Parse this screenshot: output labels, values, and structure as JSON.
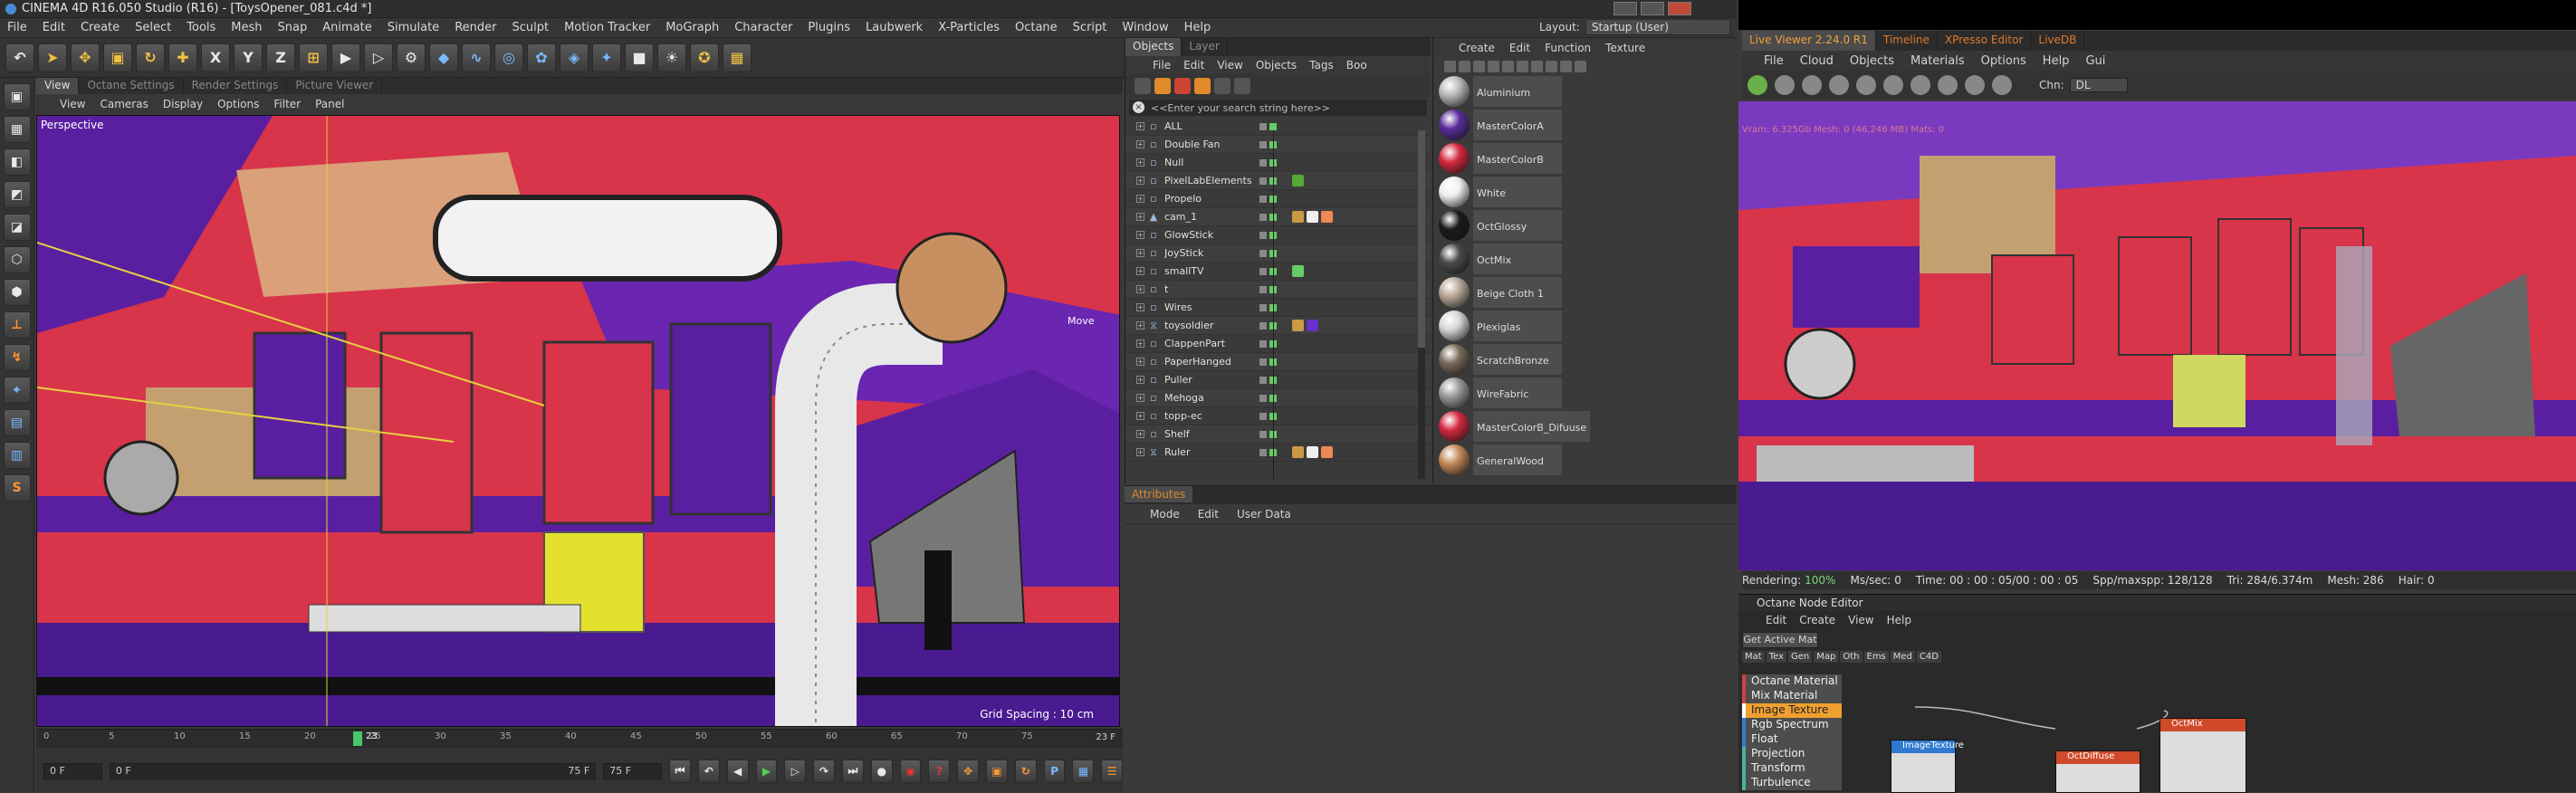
{
  "app": {
    "title": "CINEMA 4D R16.050 Studio (R16) - [ToysOpener_081.c4d *]",
    "layout_label": "Layout:",
    "layout_value": "Startup (User)"
  },
  "menu": [
    "File",
    "Edit",
    "Create",
    "Select",
    "Tools",
    "Mesh",
    "Snap",
    "Animate",
    "Simulate",
    "Render",
    "Sculpt",
    "Motion Tracker",
    "MoGraph",
    "Character",
    "Plugins",
    "Laubwerk",
    "X-Particles",
    "Octane",
    "Script",
    "Window",
    "Help"
  ],
  "toolbar_icons": [
    "undo-icon",
    "select-arrow-icon",
    "move-icon",
    "scale-icon",
    "rotate-icon",
    "move-cross-icon",
    "x-axis-icon",
    "y-axis-icon",
    "z-axis-icon",
    "coord-icon",
    "render-view-icon",
    "render-picture-icon",
    "render-settings-icon",
    "cube-icon",
    "spline-icon",
    "nurbs-icon",
    "array-icon",
    "deformer-icon",
    "scene-icon",
    "camera-icon",
    "light-icon",
    "effector-icon",
    "grid-icon"
  ],
  "axes": {
    "x": "X",
    "y": "Y",
    "z": "Z"
  },
  "viewport": {
    "tabs": [
      "View",
      "Octane Settings",
      "Render Settings",
      "Picture Viewer"
    ],
    "menu": [
      "View",
      "Cameras",
      "Display",
      "Options",
      "Filter",
      "Panel"
    ],
    "label": "Perspective",
    "grid_spacing": "Grid Spacing : 10 cm",
    "move_hint": "Move"
  },
  "timeline": {
    "ticks": [
      "0",
      "5",
      "10",
      "15",
      "20",
      "25",
      "30",
      "35",
      "40",
      "45",
      "50",
      "55",
      "60",
      "65",
      "70",
      "75"
    ],
    "current": "23",
    "end_label": "23 F",
    "start_field": "0 F",
    "min_field": "0 F",
    "max_field": "75 F",
    "end_field": "75 F"
  },
  "object_manager": {
    "tabs": [
      "Objects",
      "Layer"
    ],
    "menu": [
      "File",
      "Edit",
      "View",
      "Objects",
      "Tags",
      "Boo"
    ],
    "search_placeholder": "<<Enter your search string here>>",
    "objects": [
      {
        "name": "ALL",
        "icon": "L0"
      },
      {
        "name": "Double Fan",
        "icon": "L0"
      },
      {
        "name": "Null",
        "icon": "L0"
      },
      {
        "name": "PixelLabElements",
        "icon": "L0"
      },
      {
        "name": "Propelo",
        "icon": "L0"
      },
      {
        "name": "cam_1",
        "icon": "cam"
      },
      {
        "name": "GlowStick",
        "icon": "L0"
      },
      {
        "name": "JoyStick",
        "icon": "L0"
      },
      {
        "name": "smallTV",
        "icon": "L0"
      },
      {
        "name": "t",
        "icon": "L0"
      },
      {
        "name": "Wires",
        "icon": "L0"
      },
      {
        "name": "toysoldier",
        "icon": "sym"
      },
      {
        "name": "ClappenPart",
        "icon": "L0"
      },
      {
        "name": "PaperHanged",
        "icon": "L0"
      },
      {
        "name": "Puller",
        "icon": "L0"
      },
      {
        "name": "Mehoga",
        "icon": "L0"
      },
      {
        "name": "topp-ec",
        "icon": "L0"
      },
      {
        "name": "Shelf",
        "icon": "L0"
      },
      {
        "name": "Ruler",
        "icon": "sym"
      }
    ]
  },
  "attributes": {
    "tab": "Attributes",
    "menu": [
      "Mode",
      "Edit",
      "User Data"
    ]
  },
  "material_manager": {
    "menu": [
      "Create",
      "Edit",
      "Function",
      "Texture"
    ],
    "materials": [
      {
        "name": "Aluminium",
        "color": "#b9b9b9"
      },
      {
        "name": "MasterColorA",
        "color": "#5a2b9a"
      },
      {
        "name": "MasterColorB",
        "color": "#d4283f"
      },
      {
        "name": "White",
        "color": "#efefef"
      },
      {
        "name": "OctGlossy",
        "color": "#1a1a1a"
      },
      {
        "name": "OctMix",
        "color": "#4a4a4a"
      },
      {
        "name": "Beige Cloth 1",
        "color": "#b8a898"
      },
      {
        "name": "Plexiglas",
        "color": "#d6d6d6"
      },
      {
        "name": "ScratchBronze",
        "color": "#7a6a5a"
      },
      {
        "name": "WireFabric",
        "color": "#9a9a9a"
      },
      {
        "name": "MasterColorB_Difuuse",
        "color": "#d4283f"
      },
      {
        "name": "GeneralWood",
        "color": "#c48a5a"
      }
    ]
  },
  "live_viewer": {
    "tabs": [
      "Live Viewer 2.24.0 R1",
      "Timeline",
      "XPresso Editor",
      "LiveDB"
    ],
    "menu": [
      "File",
      "Cloud",
      "Objects",
      "Materials",
      "Options",
      "Help",
      "Gui"
    ],
    "channel_label": "Chn:",
    "channel_value": "DL",
    "overlay": "Vram: 6.325Gb   Mesh: 0 (46,246 MB)   Mats: 0",
    "status": {
      "rendering": "Rendering:",
      "rendering_val": "100%",
      "ms": "Ms/sec: 0",
      "time": "Time: 00 : 00 : 05/00 : 00 : 05",
      "spp": "Spp/maxspp: 128/128",
      "tri": "Tri: 284/6.374m",
      "mesh": "Mesh: 286",
      "hair": "Hair: 0"
    }
  },
  "node_editor": {
    "title": "Octane Node Editor",
    "menu": [
      "Edit",
      "Create",
      "View",
      "Help"
    ],
    "get_active": "Get Active Mat",
    "tabs": [
      "Mat",
      "Tex",
      "Gen",
      "Map",
      "Oth",
      "Ems",
      "Med",
      "C4D"
    ],
    "list": [
      "Octane Material",
      "Mix Material",
      "Image Texture",
      "Rgb Spectrum",
      "Float",
      "Projection",
      "Transform",
      "Turbulence"
    ],
    "nodes": [
      "ImageTexture",
      "OctDiffuse",
      "OctMix"
    ]
  },
  "colors": {
    "accent": "#e08a2a",
    "scene_red": "#d8344a",
    "scene_purple": "#5a1fa0",
    "scene_beige": "#d9a07a"
  }
}
